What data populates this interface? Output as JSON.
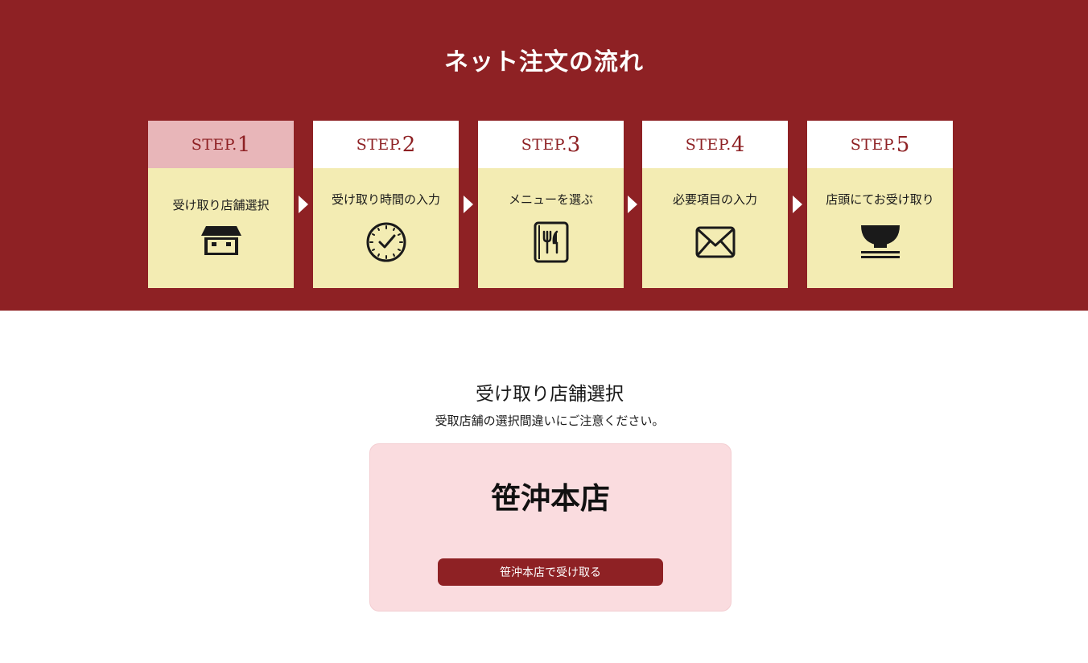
{
  "flow": {
    "title": "ネット注文の流れ",
    "step_word": "STEP.",
    "steps": [
      {
        "num": "1",
        "label": "受け取り店舗選択",
        "icon": "store-icon"
      },
      {
        "num": "2",
        "label": "受け取り時間の入力",
        "icon": "clock-icon"
      },
      {
        "num": "3",
        "label": "メニューを選ぶ",
        "icon": "menu-book-icon"
      },
      {
        "num": "4",
        "label": "必要項目の入力",
        "icon": "envelope-icon"
      },
      {
        "num": "5",
        "label": "店頭にてお受け取り",
        "icon": "rice-bowl-icon"
      }
    ],
    "active_step": "1",
    "colors": {
      "brand": "#8e2124",
      "step_body": "#f3ecb3",
      "active_head": "#e8b6b9"
    }
  },
  "store_select": {
    "title": "受け取り店舗選択",
    "note": "受取店舗の選択間違いにご注意ください。",
    "store": {
      "name": "笹沖本店",
      "button_label": "笹沖本店で受け取る"
    },
    "colors": {
      "card_bg": "#fadcdf"
    }
  }
}
